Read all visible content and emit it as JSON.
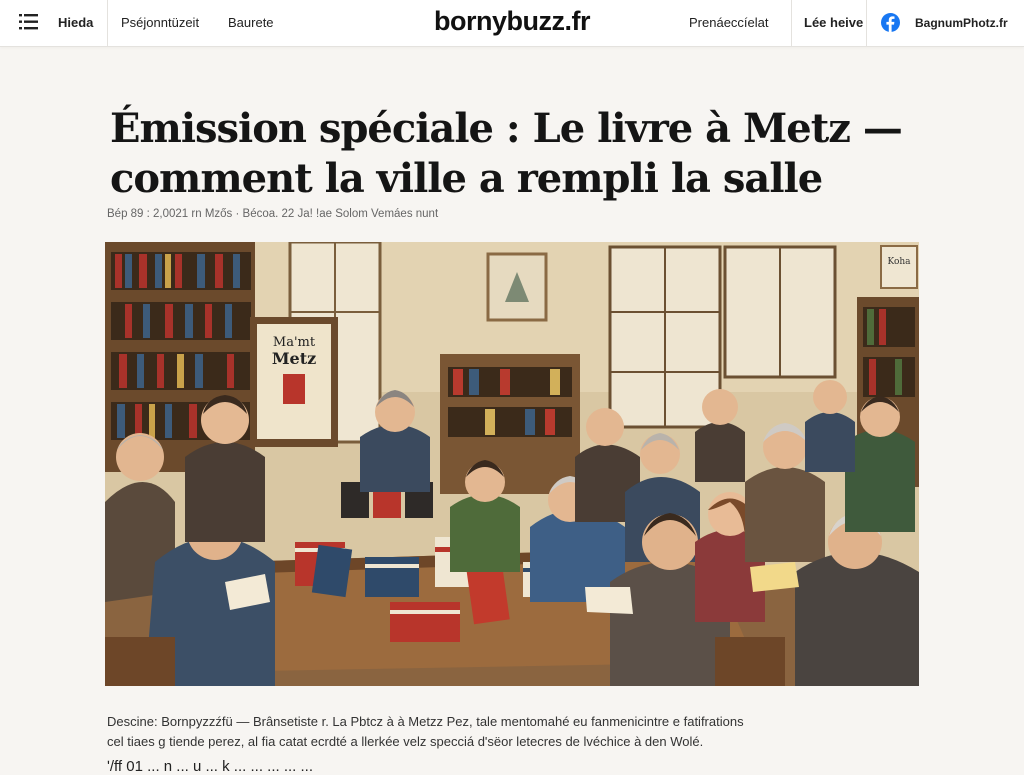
{
  "site": {
    "logo": "bornybuzz.fr"
  },
  "header": {
    "menu_icon": "hamburger-menu-icon",
    "nav_items": [
      "Hieda",
      "Pséjonntüzeit",
      "Baurete"
    ],
    "right_link_1": "Prenáeccíelat",
    "right_link_2": "Lée heive",
    "social_icon": "facebook-icon",
    "social_label": "BagnumPhotz.fr",
    "facebook_color": "#1877f2"
  },
  "article": {
    "headline": "Émission spéciale : Le livre à Metz — comment la ville a rempli la salle",
    "byline": "Bép 89 : 2,0021  rn Mzős · Bécoa. 22 Ja!  !ae Solom Vemáes  nunt",
    "image_description": "illustrated bookshop scene",
    "image_sign_text": [
      "Ma'mt",
      "Metz"
    ],
    "image_poster_text": "Koha",
    "caption_line_1": "Descine: Bornpyzzźfü — Brânsetiste r. La Pbtcz à à Metzz Pez, tale mentomahé eu fanmenicintre e fatifrations",
    "caption_line_2": "cel tiaes g tiende perez, al fia catat ecrdté a llerkée velz specciá d'sëor letecres de lvéchice à den Wolé.",
    "body_fragment": "ʹ/ff 01 ... n ... u ... k ... ... ... ... ..."
  }
}
